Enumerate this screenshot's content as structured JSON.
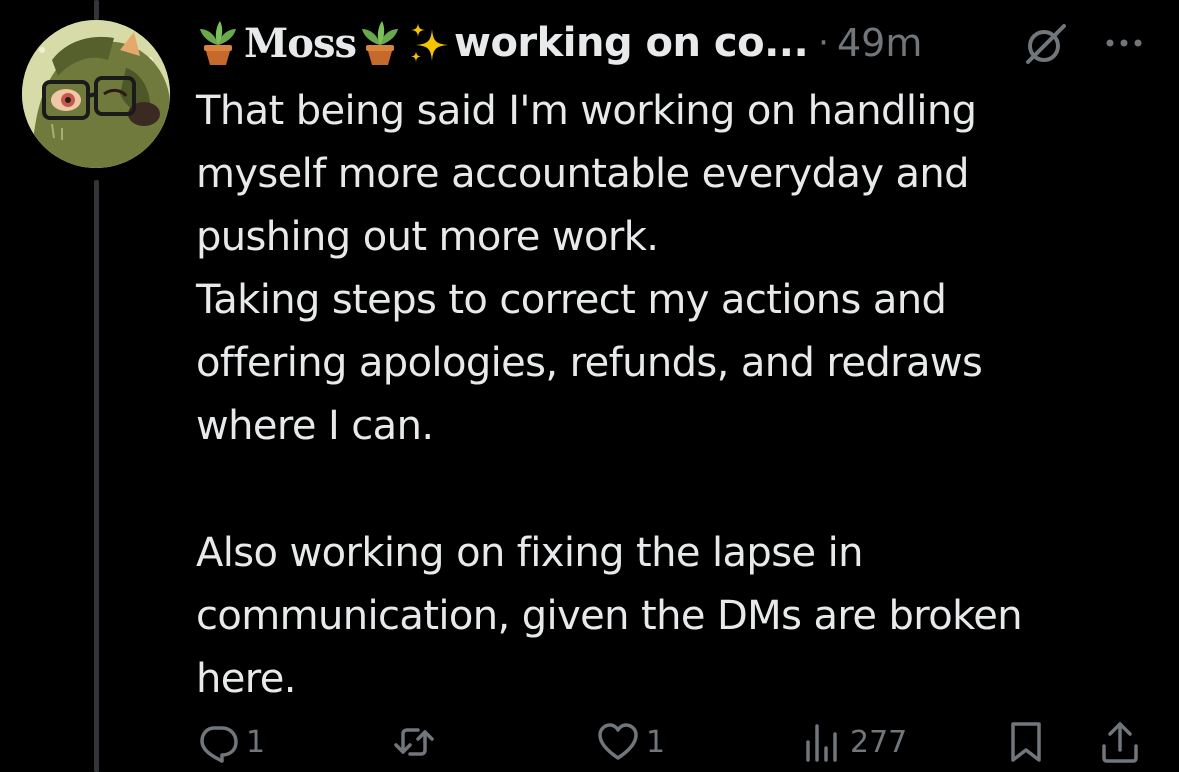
{
  "post": {
    "author": {
      "name": "Moss",
      "status": "working on co...",
      "plant_emoji": "potted-plant-emoji",
      "sparkles_emoji": "sparkles-emoji"
    },
    "separator": "·",
    "timestamp": "49m",
    "paragraph_1": "That being said I'm working on handling\nmyself more accountable everyday and\npushing out more work.\nTaking steps to correct my actions and\noffering apologies, refunds, and redraws\nwhere I can.",
    "paragraph_2": "Also working on fixing the lapse in\ncommunication, given the DMs are broken\nhere."
  },
  "actions": {
    "reply_count": "1",
    "repost_count": "",
    "like_count": "1",
    "views_count": "277"
  },
  "icons": {
    "grok": "grok-icon",
    "more": "more-icon",
    "reply": "reply-icon",
    "repost": "repost-icon",
    "like": "heart-icon",
    "views": "views-icon",
    "bookmark": "bookmark-icon",
    "share": "share-icon"
  },
  "colors": {
    "background": "#000000",
    "text": "#e7e9ea",
    "muted": "#71767b",
    "thread_line": "#333639"
  }
}
